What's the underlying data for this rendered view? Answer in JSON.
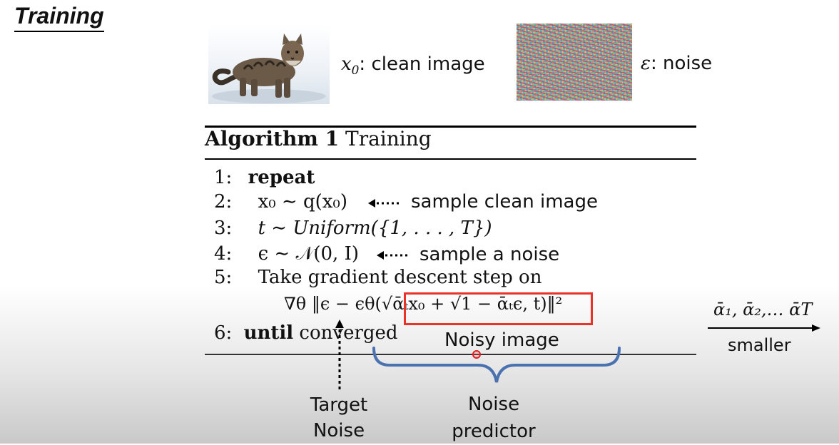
{
  "slide": {
    "title": "Training"
  },
  "images": {
    "clean_label_var": "x",
    "clean_label_sub": "0",
    "clean_label_text": ": clean image",
    "noise_label_var": "ε",
    "noise_label_text": ": noise"
  },
  "algorithm": {
    "heading_bold": "Algorithm 1",
    "heading_rest": " Training",
    "lines": [
      {
        "num": "1:",
        "text": "repeat"
      },
      {
        "num": "2:",
        "text": "x₀ ∼ q(x₀)"
      },
      {
        "num": "3:",
        "text": "t ∼ Uniform({1, . . . , T})"
      },
      {
        "num": "4:",
        "text": "ϵ ∼ 𝒩(0, I)"
      },
      {
        "num": "5:",
        "text": "Take gradient descent step on"
      },
      {
        "num": "6:",
        "text_bold": "until",
        "text_rest": " converged"
      }
    ],
    "gradient_expr": "∇θ ‖ϵ − ϵθ(√ᾱₜx₀ + √1 − ᾱₜϵ, t)‖²"
  },
  "annotations": {
    "sample_clean": "sample clean image",
    "sample_noise": "sample a noise",
    "noisy_image": "Noisy image",
    "target_noise_line1": "Target",
    "target_noise_line2": "Noise",
    "noise_predictor_line1": "Noise",
    "noise_predictor_line2": "predictor",
    "alpha_sequence": "ᾱ₁, ᾱ₂,… ᾱT",
    "smaller": "smaller"
  },
  "colors": {
    "highlight_box": "#e8332a",
    "brace": "#4a72b0",
    "cursor": "#e02020"
  }
}
